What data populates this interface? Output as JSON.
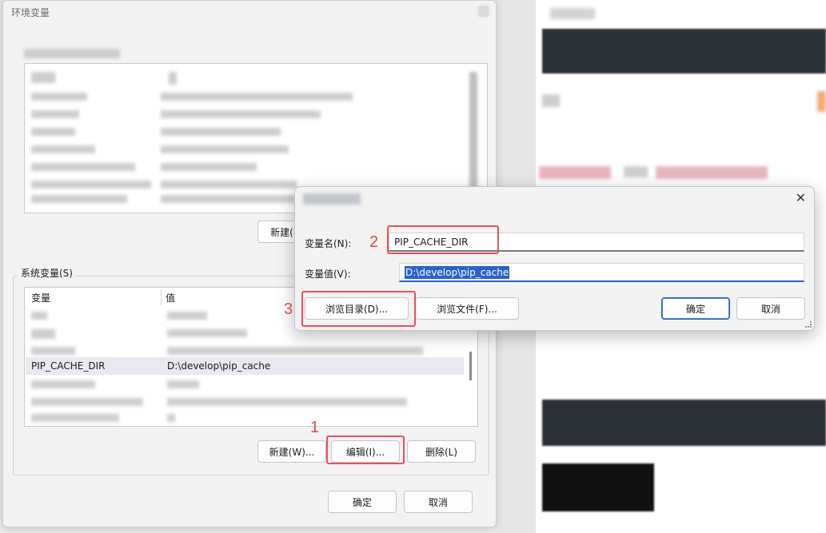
{
  "env_window": {
    "title": "环境变量",
    "user_section": {
      "new_button": "新建(N)..."
    },
    "system_section": {
      "label": "系统变量(S)",
      "columns": [
        "变量",
        "值"
      ],
      "selected_row": {
        "name": "PIP_CACHE_DIR",
        "value": "D:\\develop\\pip_cache"
      },
      "buttons": {
        "new": "新建(W)...",
        "edit": "编辑(I)...",
        "delete": "删除(L)"
      }
    },
    "footer": {
      "ok": "确定",
      "cancel": "取消"
    }
  },
  "edit_dialog": {
    "name_label": "变量名(N):",
    "name_value": "PIP_CACHE_DIR",
    "value_label": "变量值(V):",
    "value_value": "D:\\develop\\pip_cache",
    "browse_dir": "浏览目录(D)...",
    "browse_file": "浏览文件(F)...",
    "ok": "确定",
    "cancel": "取消",
    "close_glyph": "✕"
  },
  "annotations": {
    "one": "1",
    "two": "2",
    "three": "3"
  },
  "colors": {
    "callout": "#ec4f5a",
    "accent": "#2a62c9"
  }
}
